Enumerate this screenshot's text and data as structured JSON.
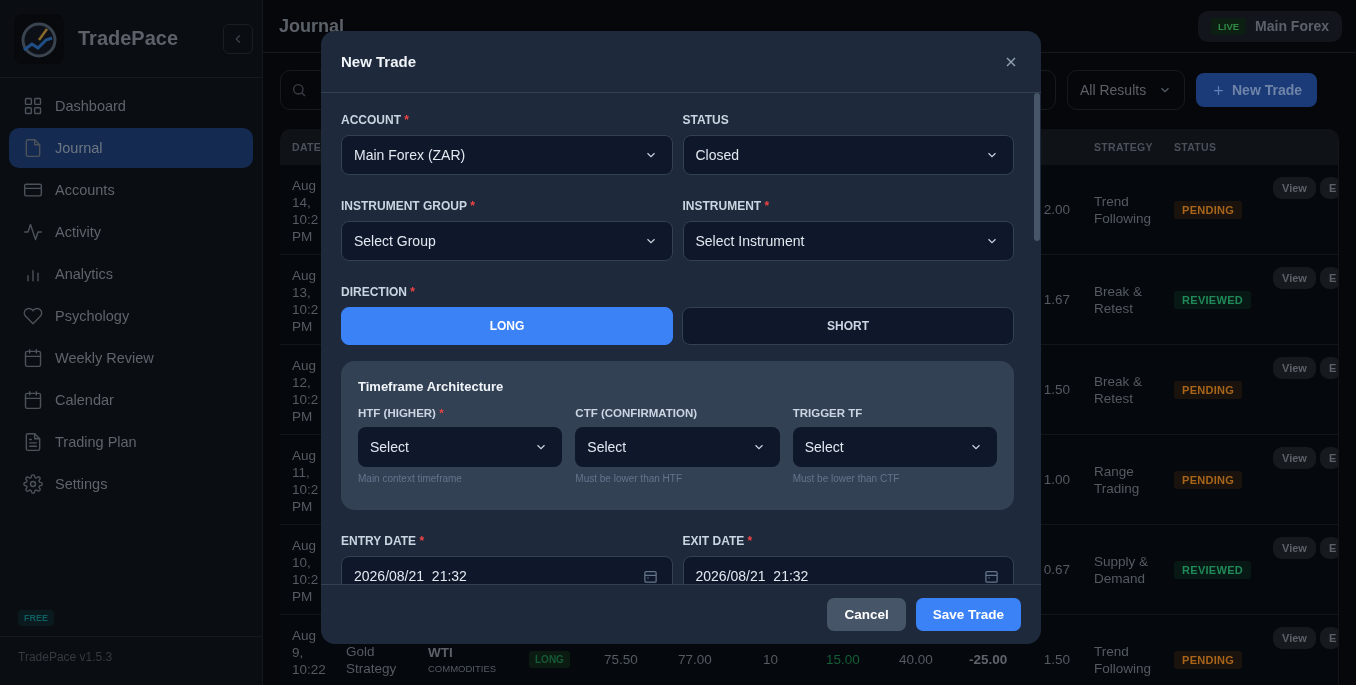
{
  "sidebar": {
    "brand": "TradePace",
    "items": [
      {
        "label": "Dashboard",
        "selected": false
      },
      {
        "label": "Journal",
        "selected": true
      },
      {
        "label": "Accounts",
        "selected": false
      },
      {
        "label": "Activity",
        "selected": false
      },
      {
        "label": "Analytics",
        "selected": false
      },
      {
        "label": "Psychology",
        "selected": false
      },
      {
        "label": "Weekly Review",
        "selected": false
      },
      {
        "label": "Calendar",
        "selected": false
      },
      {
        "label": "Trading Plan",
        "selected": false
      },
      {
        "label": "Settings",
        "selected": false
      }
    ],
    "plan_badge": "FREE",
    "version": "TradePace v1.5.3"
  },
  "header": {
    "title": "Journal",
    "account_badge": "LIVE",
    "account_name": "Main Forex"
  },
  "toolbar": {
    "filter": "All Results",
    "new_button": "New Trade"
  },
  "table": {
    "columns": [
      "DATE",
      "STRATEGY",
      "STATUS"
    ],
    "rows": [
      {
        "date": "Aug 14, 10:2 PM",
        "r": "2.00",
        "strategy": "Trend Following",
        "status": {
          "label": "PENDING",
          "color": "#a8651a"
        },
        "actions": [
          "View",
          "E"
        ]
      },
      {
        "date": "Aug 13, 10:2 PM",
        "r": "1.67",
        "strategy": "Break & Retest",
        "status": {
          "label": "REVIEWED",
          "color": "#1f8a58"
        },
        "actions": [
          "View",
          "E"
        ]
      },
      {
        "date": "Aug 12, 10:2 PM",
        "r": "1.50",
        "strategy": "Break & Retest",
        "status": {
          "label": "PENDING",
          "color": "#a8651a"
        },
        "actions": [
          "View",
          "E"
        ]
      },
      {
        "date": "Aug 11, 10:2 PM",
        "r": "1.00",
        "strategy": "Range Trading",
        "status": {
          "label": "PENDING",
          "color": "#a8651a"
        },
        "actions": [
          "View",
          "E"
        ]
      },
      {
        "date": "Aug 10, 10:2 PM",
        "r": "0.67",
        "strategy": "Supply & Demand",
        "status": {
          "label": "REVIEWED",
          "color": "#1f8a58"
        },
        "actions": [
          "View",
          "E"
        ]
      },
      {
        "date": "Aug 9, 10:22",
        "strategy_name": "Gold Strategy",
        "instrument": "WTI",
        "instrument_group": "COMMODITIES",
        "direction": "LONG",
        "entry": "75.50",
        "exit": "77.00",
        "size": "10",
        "pnl": "15.00",
        "pnl_positive": true,
        "fees": "40.00",
        "net": "-25.00",
        "r": "1.50",
        "strategy": "Trend Following",
        "status": {
          "label": "PENDING",
          "color": "#a8651a"
        },
        "actions": [
          "View",
          "E"
        ]
      }
    ]
  },
  "modal": {
    "title": "New Trade",
    "fields": [
      {
        "label": "ACCOUNT",
        "mark": "*",
        "value": "Main Forex (ZAR)"
      },
      {
        "label": "STATUS",
        "value": "Closed"
      },
      {
        "label": "INSTRUMENT GROUP",
        "mark": "*",
        "value": "Select Group"
      },
      {
        "label": "INSTRUMENT",
        "mark": "*",
        "value": "Select Instrument"
      }
    ],
    "direction": {
      "label": "DIRECTION",
      "mark": "*",
      "options": [
        {
          "label": "LONG",
          "selected": true
        },
        {
          "label": "SHORT",
          "selected": false
        }
      ]
    },
    "timeframes": {
      "title": "Timeframe Architecture",
      "fields": [
        {
          "label": "HTF (HIGHER)",
          "mark": "*",
          "value": "Select",
          "hint": "Main context timeframe"
        },
        {
          "label": "CTF (CONFIRMATION)",
          "value": "Select",
          "hint": "Must be lower than HTF"
        },
        {
          "label": "TRIGGER TF",
          "value": "Select",
          "hint": "Must be lower than CTF"
        }
      ]
    },
    "dates": [
      {
        "label": "ENTRY DATE",
        "mark": "*",
        "value": "2026/08/21  21:32"
      },
      {
        "label": "EXIT DATE",
        "mark": "*",
        "value": "2026/08/21  21:32"
      }
    ],
    "buttons": [
      {
        "label": "Cancel",
        "kind": "secondary"
      },
      {
        "label": "Save Trade",
        "kind": "primary"
      }
    ]
  }
}
